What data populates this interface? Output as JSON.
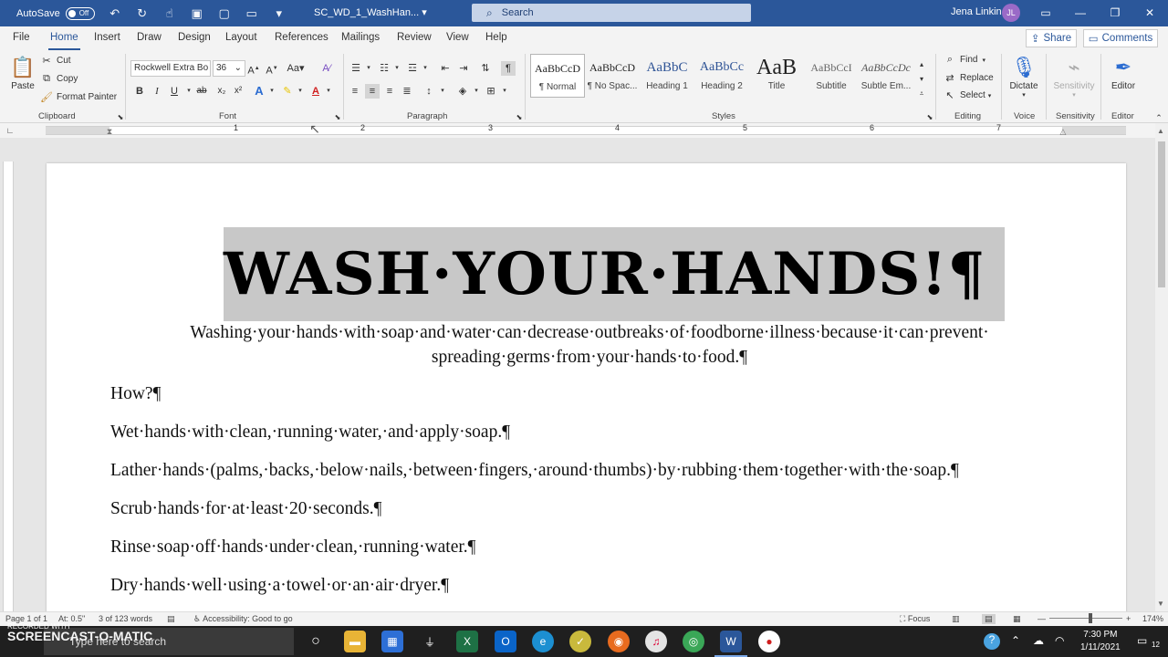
{
  "titlebar": {
    "autosave_label": "AutoSave",
    "autosave_state": "Off",
    "doc_title": "SC_WD_1_WashHan...",
    "search_placeholder": "Search",
    "user_name": "Jena Linkin",
    "user_initials": "JL"
  },
  "tabs": [
    "File",
    "Home",
    "Insert",
    "Draw",
    "Design",
    "Layout",
    "References",
    "Mailings",
    "Review",
    "View",
    "Help"
  ],
  "active_tab": "Home",
  "share_label": "Share",
  "comments_label": "Comments",
  "clipboard": {
    "paste": "Paste",
    "cut": "Cut",
    "copy": "Copy",
    "format_painter": "Format Painter",
    "label": "Clipboard"
  },
  "font": {
    "name": "Rockwell Extra Bo",
    "size": "36",
    "label": "Font"
  },
  "paragraph_label": "Paragraph",
  "styles": {
    "items": [
      {
        "sample": "AaBbCcD",
        "name": "¶ Normal"
      },
      {
        "sample": "AaBbCcD",
        "name": "¶ No Spac..."
      },
      {
        "sample": "AaBbC",
        "name": "Heading 1"
      },
      {
        "sample": "AaBbCc",
        "name": "Heading 2"
      },
      {
        "sample": "AaB",
        "name": "Title"
      },
      {
        "sample": "AaBbCcI",
        "name": "Subtitle"
      },
      {
        "sample": "AaBbCcDc",
        "name": "Subtle Em..."
      }
    ],
    "label": "Styles"
  },
  "editing": {
    "find": "Find",
    "replace": "Replace",
    "select": "Select",
    "label": "Editing"
  },
  "voice": {
    "dictate": "Dictate",
    "label": "Voice"
  },
  "sensitivity": {
    "button": "Sensitivity",
    "label": "Sensitivity"
  },
  "editor": {
    "button": "Editor",
    "label": "Editor"
  },
  "ruler_numbers": [
    "1",
    "2",
    "3",
    "4",
    "5",
    "6",
    "7"
  ],
  "document": {
    "heading": "WASH·YOUR·HANDS!¶",
    "intro_line1": "Washing·your·hands·with·soap·and·water·can·decrease·outbreaks·of·foodborne·illness·because·it·can·prevent·",
    "intro_line2": "spreading·germs·from·your·hands·to·food.¶",
    "paragraphs": [
      "How?¶",
      "Wet·hands·with·clean,·running·water,·and·apply·soap.¶",
      "Lather·hands·(palms,·backs,·below·nails,·between·fingers,·around·thumbs)·by·rubbing·them·together·with·the·soap.¶",
      "Scrub·hands·for·at·least·20·seconds.¶",
      "Rinse·soap·off·hands·under·clean,·running·water.¶",
      "Dry·hands·well·using·a·towel·or·an·air·dryer.¶"
    ]
  },
  "statusbar": {
    "page": "Page 1 of 1",
    "at": "At: 0.5\"",
    "words": "3 of 123 words",
    "accessibility": "Accessibility: Good to go",
    "focus": "Focus",
    "zoom": "174%"
  },
  "taskbar": {
    "search_placeholder": "Type here to search",
    "time": "7:30 PM",
    "date": "1/11/2021",
    "notifications": "12"
  },
  "watermark": {
    "line1": "RECORDED WITH",
    "line2": "SCREENCAST-O-MATIC"
  },
  "colors": {
    "brand": "#2b579a",
    "highlight": "#c8c8c8"
  }
}
